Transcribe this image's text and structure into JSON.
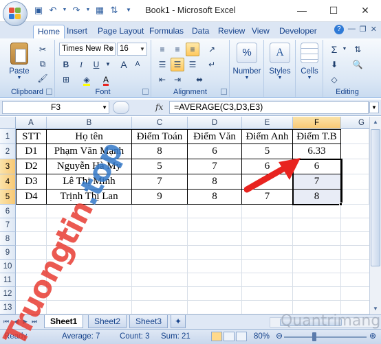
{
  "window": {
    "title": "Book1 - Microsoft Excel",
    "min_glyph": "—",
    "max_glyph": "☐",
    "close_glyph": "✕"
  },
  "qat_icons": [
    "save-icon",
    "undo-icon",
    "redo-icon",
    "table-icon",
    "sort-icon"
  ],
  "tabs": [
    "Home",
    "Insert",
    "Page Layout",
    "Formulas",
    "Data",
    "Review",
    "View",
    "Developer"
  ],
  "ribbon": {
    "clipboard": {
      "label": "Clipboard",
      "paste": "Paste"
    },
    "font": {
      "label": "Font",
      "face": "Times New Ro",
      "size": "16",
      "bold": "B",
      "italic": "I",
      "underline": "U",
      "grow": "A",
      "shrink": "A",
      "color_a": "A"
    },
    "alignment": {
      "label": "Alignment"
    },
    "number": {
      "label": "Number",
      "symbol": "%"
    },
    "styles": {
      "label": "Styles"
    },
    "cells": {
      "label": "Cells"
    },
    "editing": {
      "label": "Editing",
      "sum": "Σ"
    }
  },
  "formula_bar": {
    "name_box": "F3",
    "fx": "fx",
    "formula": "=AVERAGE(C3,D3,E3)"
  },
  "columns": [
    "A",
    "B",
    "C",
    "D",
    "E",
    "F",
    "G"
  ],
  "rows": [
    "1",
    "2",
    "3",
    "4",
    "5",
    "6",
    "7",
    "8",
    "9",
    "10",
    "11",
    "12",
    "13"
  ],
  "table": {
    "header": [
      "STT",
      "Họ tên",
      "Điểm Toán",
      "Điểm Văn",
      "Điểm Anh",
      "Điểm T.B"
    ],
    "rows": [
      [
        "D1",
        "Phạm Văn Mạnh",
        "8",
        "6",
        "5",
        "6.33"
      ],
      [
        "D2",
        "Nguyễn Hà My",
        "5",
        "7",
        "6",
        "6"
      ],
      [
        "D3",
        "Lê Thị Minh",
        "7",
        "8",
        "",
        "7"
      ],
      [
        "D4",
        "Trịnh Thị Lan",
        "9",
        "8",
        "7",
        "8"
      ]
    ]
  },
  "sheets": [
    "Sheet1",
    "Sheet2",
    "Sheet3"
  ],
  "status": {
    "mode": "Ready",
    "average": "Average: 7",
    "count": "Count: 3",
    "sum": "Sum: 21",
    "zoom": "80%"
  },
  "watermarks": {
    "left_red": "Truongtin",
    "left_blue": ".top",
    "right": "Quantrimang"
  },
  "colors": {
    "accent": "#15428b",
    "ribbon": "#dbe7f5",
    "selection": "#f8c874",
    "arrow": "#e8231f"
  }
}
